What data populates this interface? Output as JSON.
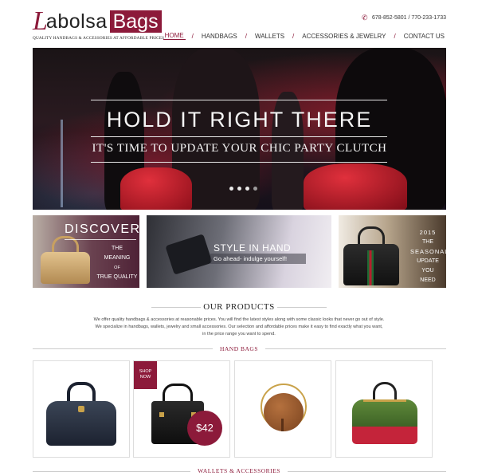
{
  "brand": {
    "logo_letter": "L",
    "logo_word": "abolsa",
    "logo_box": "Bags",
    "tagline": "QUALITY HANDBAGS & ACCESSORIES AT AFFORDABLE PRICES"
  },
  "contact": {
    "phones": "678-852-5801 / 770-233-1733",
    "icon": "phone-icon"
  },
  "nav": {
    "items": [
      {
        "label": "HOME",
        "active": true
      },
      {
        "label": "HANDBAGS"
      },
      {
        "label": "WALLETS"
      },
      {
        "label": "ACCESSORIES & JEWELRY"
      },
      {
        "label": "CONTACT US"
      }
    ],
    "separator": "/"
  },
  "hero": {
    "title": "HOLD IT RIGHT THERE",
    "subtitle": "IT'S TIME TO UPDATE YOUR CHIC PARTY CLUTCH",
    "slide_count": 4,
    "active_slide": 4
  },
  "promos": {
    "discover": {
      "heading": "DISCOVER",
      "line1": "THE",
      "line2": "MEANING",
      "line3": "OF",
      "line4": "TRUE QUALITY"
    },
    "style": {
      "heading": "STYLE IN HAND",
      "sub": "Go ahead- indulge yourself!"
    },
    "seasonal": {
      "line1": "2015",
      "line2": "THE",
      "line3": "SEASONAL",
      "line4": "UPDATE",
      "line5": "YOU",
      "line6": "NEED"
    }
  },
  "products": {
    "title": "OUR PRODUCTS",
    "intro1": "We offer quality handbags & accessories at reasonable prices. You will find the latest styles along with some classic looks that never go out of style.",
    "intro2": "We specialize in handbags, wallets, jewelry and small accessories. Our selection and affordable prices make it easy to find exactly what you want,",
    "intro3": "in the price range you want to spend."
  },
  "categories": {
    "handbags": "HAND BAGS",
    "wallets": "WALLETS & ACCESSORIES"
  },
  "cards": {
    "shop_now_1": "SHOP",
    "shop_now_2": "NOW",
    "price": "$42"
  },
  "colors": {
    "accent": "#8c1a3a"
  }
}
